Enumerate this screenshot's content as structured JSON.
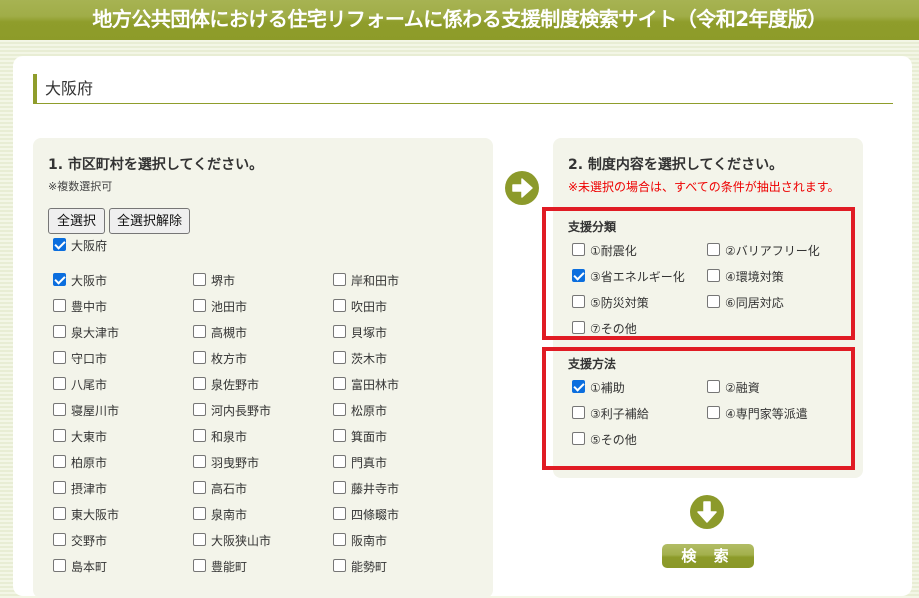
{
  "header": {
    "title": "地方公共団体における住宅リフォームに係わる支援制度検索サイト（令和2年度版）"
  },
  "prefecture": {
    "name": "大阪府"
  },
  "step1": {
    "title": "1. 市区町村を選択してください。",
    "note": "※複数選択可",
    "select_all_label": "全選択",
    "deselect_all_label": "全選択解除",
    "prefecture_checkbox": {
      "label": "大阪府",
      "checked": true
    },
    "cities": [
      {
        "label": "大阪市",
        "checked": true
      },
      {
        "label": "堺市",
        "checked": false
      },
      {
        "label": "岸和田市",
        "checked": false
      },
      {
        "label": "豊中市",
        "checked": false
      },
      {
        "label": "池田市",
        "checked": false
      },
      {
        "label": "吹田市",
        "checked": false
      },
      {
        "label": "泉大津市",
        "checked": false
      },
      {
        "label": "高槻市",
        "checked": false
      },
      {
        "label": "貝塚市",
        "checked": false
      },
      {
        "label": "守口市",
        "checked": false
      },
      {
        "label": "枚方市",
        "checked": false
      },
      {
        "label": "茨木市",
        "checked": false
      },
      {
        "label": "八尾市",
        "checked": false
      },
      {
        "label": "泉佐野市",
        "checked": false
      },
      {
        "label": "富田林市",
        "checked": false
      },
      {
        "label": "寝屋川市",
        "checked": false
      },
      {
        "label": "河内長野市",
        "checked": false
      },
      {
        "label": "松原市",
        "checked": false
      },
      {
        "label": "大東市",
        "checked": false
      },
      {
        "label": "和泉市",
        "checked": false
      },
      {
        "label": "箕面市",
        "checked": false
      },
      {
        "label": "柏原市",
        "checked": false
      },
      {
        "label": "羽曳野市",
        "checked": false
      },
      {
        "label": "門真市",
        "checked": false
      },
      {
        "label": "摂津市",
        "checked": false
      },
      {
        "label": "高石市",
        "checked": false
      },
      {
        "label": "藤井寺市",
        "checked": false
      },
      {
        "label": "東大阪市",
        "checked": false
      },
      {
        "label": "泉南市",
        "checked": false
      },
      {
        "label": "四條畷市",
        "checked": false
      },
      {
        "label": "交野市",
        "checked": false
      },
      {
        "label": "大阪狭山市",
        "checked": false
      },
      {
        "label": "阪南市",
        "checked": false
      },
      {
        "label": "島本町",
        "checked": false
      },
      {
        "label": "豊能町",
        "checked": false
      },
      {
        "label": "能勢町",
        "checked": false
      }
    ]
  },
  "step2": {
    "title": "2. 制度内容を選択してください。",
    "note": "※未選択の場合は、すべての条件が抽出されます。",
    "support_category": {
      "title": "支援分類",
      "options": [
        {
          "label": "①耐震化",
          "checked": false
        },
        {
          "label": "②バリアフリー化",
          "checked": false
        },
        {
          "label": "③省エネルギー化",
          "checked": true
        },
        {
          "label": "④環境対策",
          "checked": false
        },
        {
          "label": "⑤防災対策",
          "checked": false
        },
        {
          "label": "⑥同居対応",
          "checked": false
        },
        {
          "label": "⑦その他",
          "checked": false
        }
      ]
    },
    "support_method": {
      "title": "支援方法",
      "options": [
        {
          "label": "①補助",
          "checked": true
        },
        {
          "label": "②融資",
          "checked": false
        },
        {
          "label": "③利子補給",
          "checked": false
        },
        {
          "label": "④専門家等派遣",
          "checked": false
        },
        {
          "label": "⑤その他",
          "checked": false
        }
      ]
    }
  },
  "icons": {
    "next_step": "arrow-right-circle",
    "to_search": "arrow-down-circle"
  },
  "search_button": {
    "label": "検 索"
  },
  "colors": {
    "brand": "#8f9d2b",
    "highlight_border": "#e01b24",
    "note_red": "#ee0000",
    "checkbox_checked": "#0b6ede"
  }
}
